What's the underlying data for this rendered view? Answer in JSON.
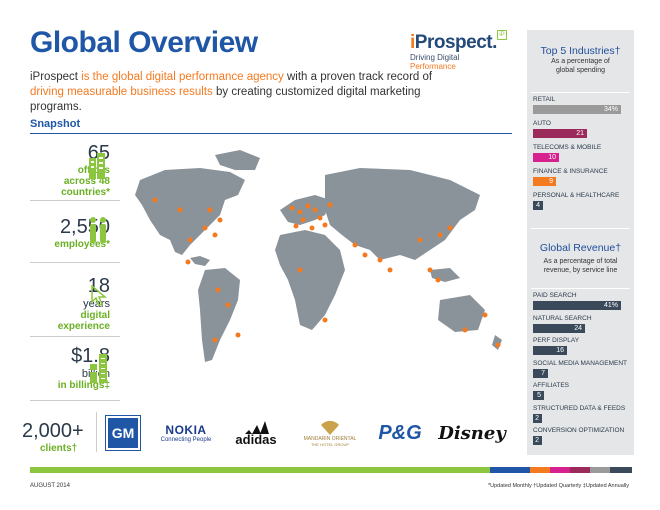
{
  "header": {
    "title": "Global Overview",
    "logo_i": "i",
    "logo_rest": "Prospect.",
    "logo_tag_1": "Driving Digital ",
    "logo_tag_2": "Performance",
    "logo_badge": "iP"
  },
  "intro": {
    "p1": "iProspect ",
    "p2": "is the global digital performance agency",
    "p3": " with a proven track record of ",
    "p4": "driving measurable business results",
    "p5": " by creating customized digital marketing programs."
  },
  "snapshot": {
    "title": "Snapshot",
    "stats": [
      {
        "big": "65",
        "lines": [
          "offices",
          "across 48",
          "countries*"
        ],
        "icon": "building-icon"
      },
      {
        "big": "2,550",
        "lines": [
          "employees*"
        ],
        "icon": "people-icon"
      },
      {
        "big": "18",
        "unit": "years",
        "lines": [
          "digital",
          "experience"
        ],
        "icon": "cursor-icon"
      },
      {
        "big": "$1.8",
        "unit": "billion",
        "lines": [
          "in billings‡"
        ],
        "icon": "money-icon"
      }
    ]
  },
  "clients": {
    "count": "2,000+",
    "label": "clients†",
    "brands": [
      "GM",
      "NOKIA",
      "Connecting People",
      "adidas",
      "MANDARIN ORIENTAL",
      "THE HOTEL GROUP",
      "P&G",
      "Disney"
    ]
  },
  "sidebar": {
    "industries_title": "Top 5 Industries†",
    "industries_sub": "As a percentage of global spending",
    "industries": [
      {
        "label": "RETAIL",
        "value": "34%",
        "pct": 34,
        "color": "#9a9a9a"
      },
      {
        "label": "AUTO",
        "value": "21",
        "pct": 21,
        "color": "#9b2a5a"
      },
      {
        "label": "TELECOMS & MOBILE",
        "value": "10",
        "pct": 10,
        "color": "#d6218f"
      },
      {
        "label": "FINANCE & INSURANCE",
        "value": "9",
        "pct": 9,
        "color": "#f47a20"
      },
      {
        "label": "PERSONAL & HEALTHCARE",
        "value": "4",
        "pct": 4,
        "color": "#3a4a5a"
      }
    ],
    "revenue_title": "Global Revenue†",
    "revenue_sub": "As a percentage of total revenue, by service line",
    "revenue": [
      {
        "label": "PAID SEARCH",
        "value": "41%",
        "pct": 41
      },
      {
        "label": "NATURAL SEARCH",
        "value": "24",
        "pct": 24
      },
      {
        "label": "PERF DISPLAY",
        "value": "16",
        "pct": 16
      },
      {
        "label": "SOCIAL MEDIA MANAGEMENT",
        "value": "7",
        "pct": 7
      },
      {
        "label": "AFFILIATES",
        "value": "5",
        "pct": 5
      },
      {
        "label": "STRUCTURED DATA & FEEDS",
        "value": "2",
        "pct": 2
      },
      {
        "label": "CONVERSION OPTIMIZATION",
        "value": "2",
        "pct": 2
      }
    ],
    "revenue_color": "#3a4a5a"
  },
  "footer": {
    "date": "AUGUST 2014",
    "notes": "*Updated Monthly   †Updated Quarterly   ‡Updated Annually",
    "stripe_colors": [
      "#8cc63f",
      "#8cc63f",
      "#8cc63f",
      "#8cc63f",
      "#1f56a6",
      "#f47a20",
      "#d6218f",
      "#9b2a5a",
      "#9a9a9a",
      "#3a4a5a"
    ]
  }
}
